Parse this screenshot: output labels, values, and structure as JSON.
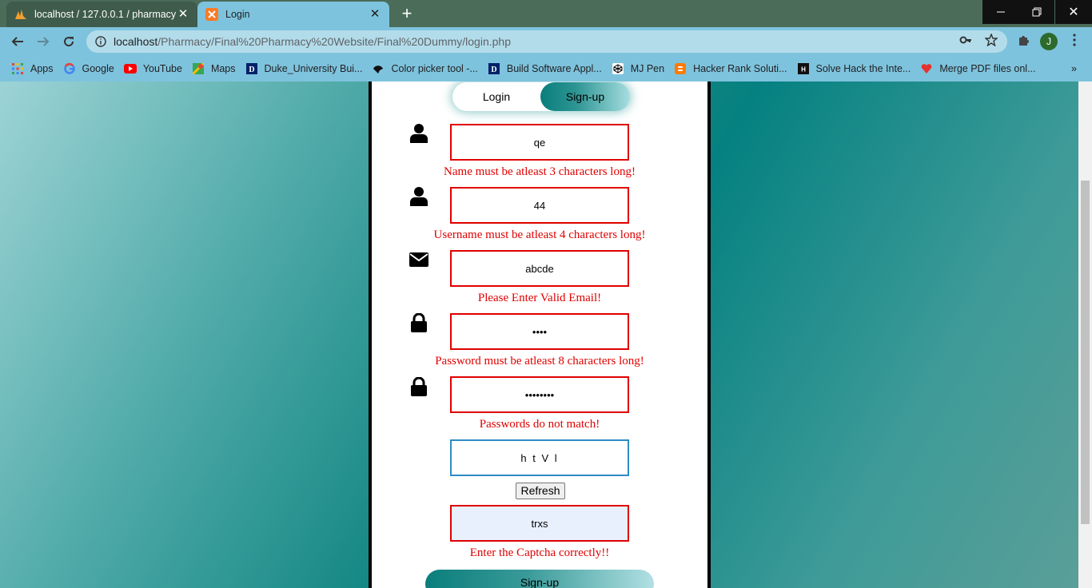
{
  "browser": {
    "tabs": [
      {
        "title": "localhost / 127.0.0.1 / pharmacy |"
      },
      {
        "title": "Login"
      }
    ],
    "url_host": "localhost",
    "url_path": "/Pharmacy/Final%20Pharmacy%20Website/Final%20Dummy/login.php",
    "profile_initial": "J"
  },
  "bookmarks": [
    {
      "label": "Apps",
      "icon": "apps-grid-icon"
    },
    {
      "label": "Google",
      "icon": "google-icon"
    },
    {
      "label": "YouTube",
      "icon": "youtube-icon"
    },
    {
      "label": "Maps",
      "icon": "maps-icon"
    },
    {
      "label": "Duke_University Bui...",
      "icon": "duke-icon"
    },
    {
      "label": "Color picker tool -...",
      "icon": "color-picker-icon"
    },
    {
      "label": "Build Software Appl...",
      "icon": "duke-icon"
    },
    {
      "label": "MJ Pen",
      "icon": "codepen-icon"
    },
    {
      "label": "Hacker Rank Soluti...",
      "icon": "blogger-icon"
    },
    {
      "label": "Solve Hack the Inte...",
      "icon": "hackerrank-icon"
    },
    {
      "label": "Merge PDF files onl...",
      "icon": "heart-icon"
    }
  ],
  "form": {
    "toggle_login": "Login",
    "toggle_signup": "Sign-up",
    "name_value": "qe",
    "name_error": "Name must be atleast 3 characters long!",
    "username_value": "44",
    "username_error": "Username must be atleast 4 characters long!",
    "email_value": "abcde",
    "email_error": "Please Enter Valid Email!",
    "password_value": "••••",
    "password_error": "Password must be atleast 8 characters long!",
    "confirm_value": "••••••••",
    "confirm_error": "Passwords do not match!",
    "captcha_text": "h t V l",
    "refresh_label": "Refresh",
    "captcha_value": "trxs",
    "captcha_error": "Enter the Captcha correctly!!",
    "submit_label": "Sign-up"
  },
  "colors": {
    "error": "#e00000",
    "accent_teal": "#0a7e7c"
  }
}
